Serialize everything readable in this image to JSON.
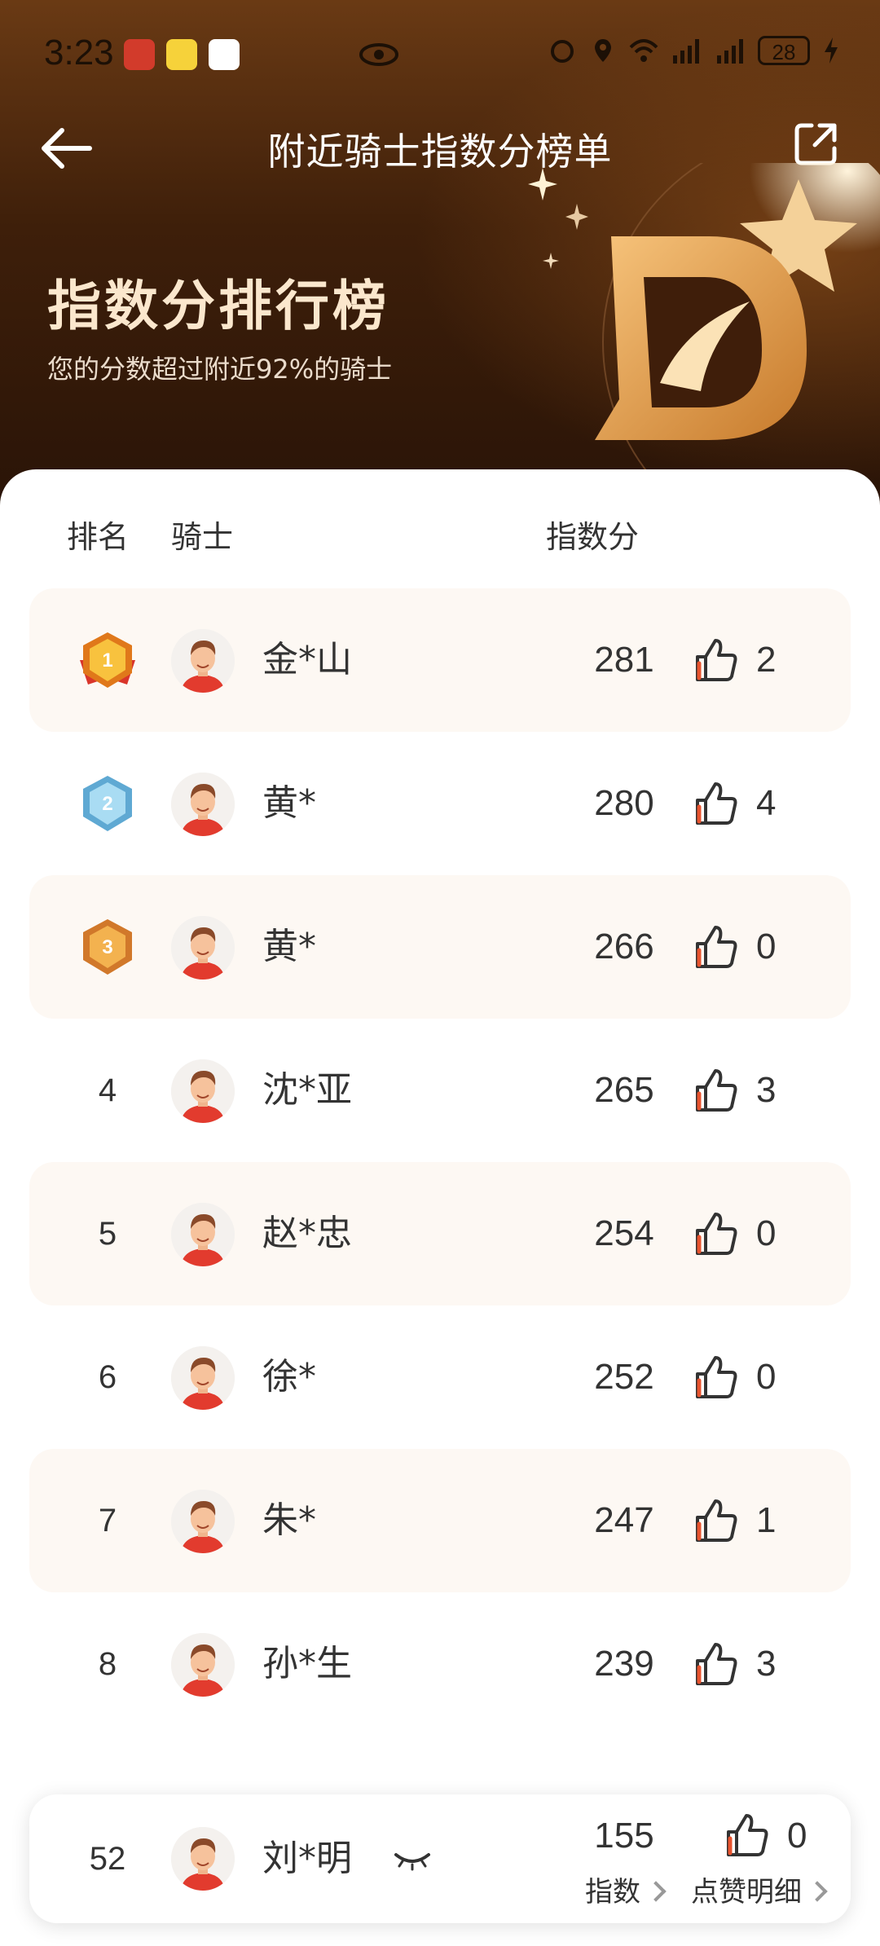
{
  "status_bar": {
    "time": "3:23",
    "battery": "28"
  },
  "header": {
    "title": "附近骑士指数分榜单",
    "hero_title": "指数分排行榜",
    "hero_subtitle": "您的分数超过附近92%的骑士"
  },
  "columns": {
    "rank": "排名",
    "rider": "骑士",
    "score": "指数分"
  },
  "riders": [
    {
      "rank": "1",
      "name": "金*山",
      "score": "281",
      "likes": "2"
    },
    {
      "rank": "2",
      "name": "黄*",
      "score": "280",
      "likes": "4"
    },
    {
      "rank": "3",
      "name": "黄*",
      "score": "266",
      "likes": "0"
    },
    {
      "rank": "4",
      "name": "沈*亚",
      "score": "265",
      "likes": "3"
    },
    {
      "rank": "5",
      "name": "赵*忠",
      "score": "254",
      "likes": "0"
    },
    {
      "rank": "6",
      "name": "徐*",
      "score": "252",
      "likes": "0"
    },
    {
      "rank": "7",
      "name": "朱*",
      "score": "247",
      "likes": "1"
    },
    {
      "rank": "8",
      "name": "孙*生",
      "score": "239",
      "likes": "3"
    }
  ],
  "my_card": {
    "rank": "52",
    "name": "刘*明",
    "score": "155",
    "score_link": "指数",
    "likes": "0",
    "likes_link": "点赞明细"
  },
  "colors": {
    "hero_dark": "#2a1407",
    "hero_accent": "#e8a653",
    "row_alt": "#fdf8f3",
    "like_accent": "#e8532e"
  }
}
